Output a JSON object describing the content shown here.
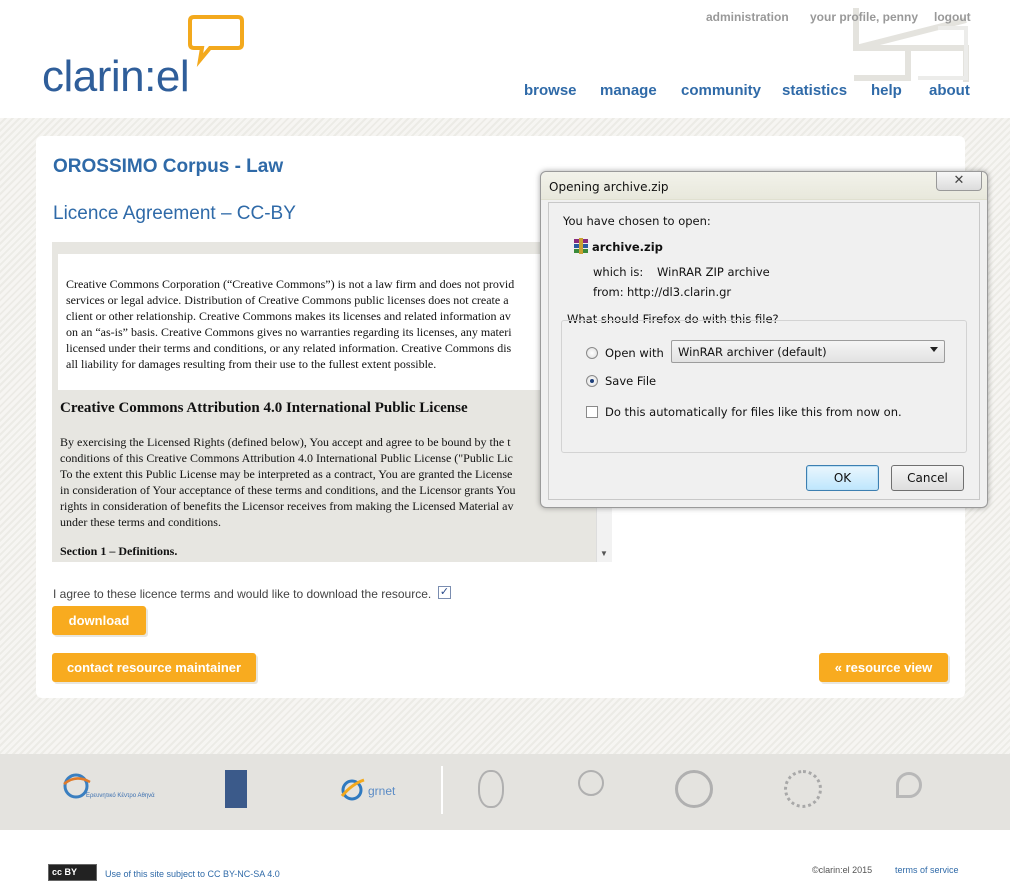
{
  "header": {
    "logo_text": "clarin:el",
    "top_links": {
      "administration": "administration",
      "profile": "your profile, penny",
      "logout": "logout"
    },
    "nav": {
      "browse": "browse",
      "manage": "manage",
      "community": "community",
      "statistics": "statistics",
      "help": "help",
      "about": "about"
    }
  },
  "page": {
    "resource_title": "OROSSIMO Corpus - Law",
    "licence_title": "Licence Agreement – CC-BY",
    "licence_text": {
      "intro_lines": [
        "Creative Commons Corporation (“Creative Commons”) is not a law firm and does not provid",
        "services or legal advice. Distribution of Creative Commons public licenses does not create a",
        "client or other relationship. Creative Commons makes its licenses and related information av",
        "on an “as-is” basis. Creative Commons gives no warranties regarding its licenses, any materi",
        "licensed under their terms and conditions, or any related information. Creative Commons dis",
        "all liability for damages resulting from their use to the fullest extent possible."
      ],
      "heading": "Creative Commons Attribution 4.0 International Public License",
      "body_lines": [
        "By exercising the Licensed Rights (defined below), You accept and agree to be bound by the t",
        "conditions of this Creative Commons Attribution 4.0 International Public License (\"Public Lic",
        "To the extent this Public License may be interpreted as a contract, You are granted the License",
        "in consideration of Your acceptance of these terms and conditions, and the Licensor grants You",
        "rights in consideration of benefits the Licensor receives from making the Licensed Material av",
        "under these terms and conditions."
      ],
      "section": "Section 1 – Definitions."
    },
    "agree_text": "I agree to these licence terms and would like to download the resource.",
    "agree_checked": true,
    "download_label": "download",
    "contact_label": "contact resource maintainer",
    "resource_view_label": "« resource view"
  },
  "dialog": {
    "title": "Opening archive.zip",
    "close_glyph": "✕",
    "chosen_label": "You have chosen to open:",
    "file_name": "archive.zip",
    "which_is_label": "which is:",
    "which_is_value": "WinRAR ZIP archive",
    "from_label": "from:",
    "from_value": "http://dl3.clarin.gr",
    "question": "What should Firefox do with this file?",
    "open_with_label": "Open with",
    "open_with_selected": "WinRAR archiver (default)",
    "save_file_label": "Save File",
    "selected_option": "save_file",
    "auto_label": "Do this automatically for files like this from now on.",
    "auto_checked": false,
    "ok_label": "OK",
    "cancel_label": "Cancel"
  },
  "footer": {
    "logos": [
      "athena-rc-logo",
      "academy-logo",
      "grnet-logo",
      "athens-university-logo",
      "aristotle-university-logo",
      "ionian-university-logo",
      "patras-university-logo",
      "ilsp-logo"
    ],
    "athena_text": "Ερευνητικό Κέντρο Αθηνά",
    "grnet_text": "grnet",
    "cc_badge": "cc BY",
    "cc_text": "Use of this site subject to CC BY-NC-SA 4.0",
    "copyright": "©clarin:el 2015",
    "terms": "terms of service"
  }
}
